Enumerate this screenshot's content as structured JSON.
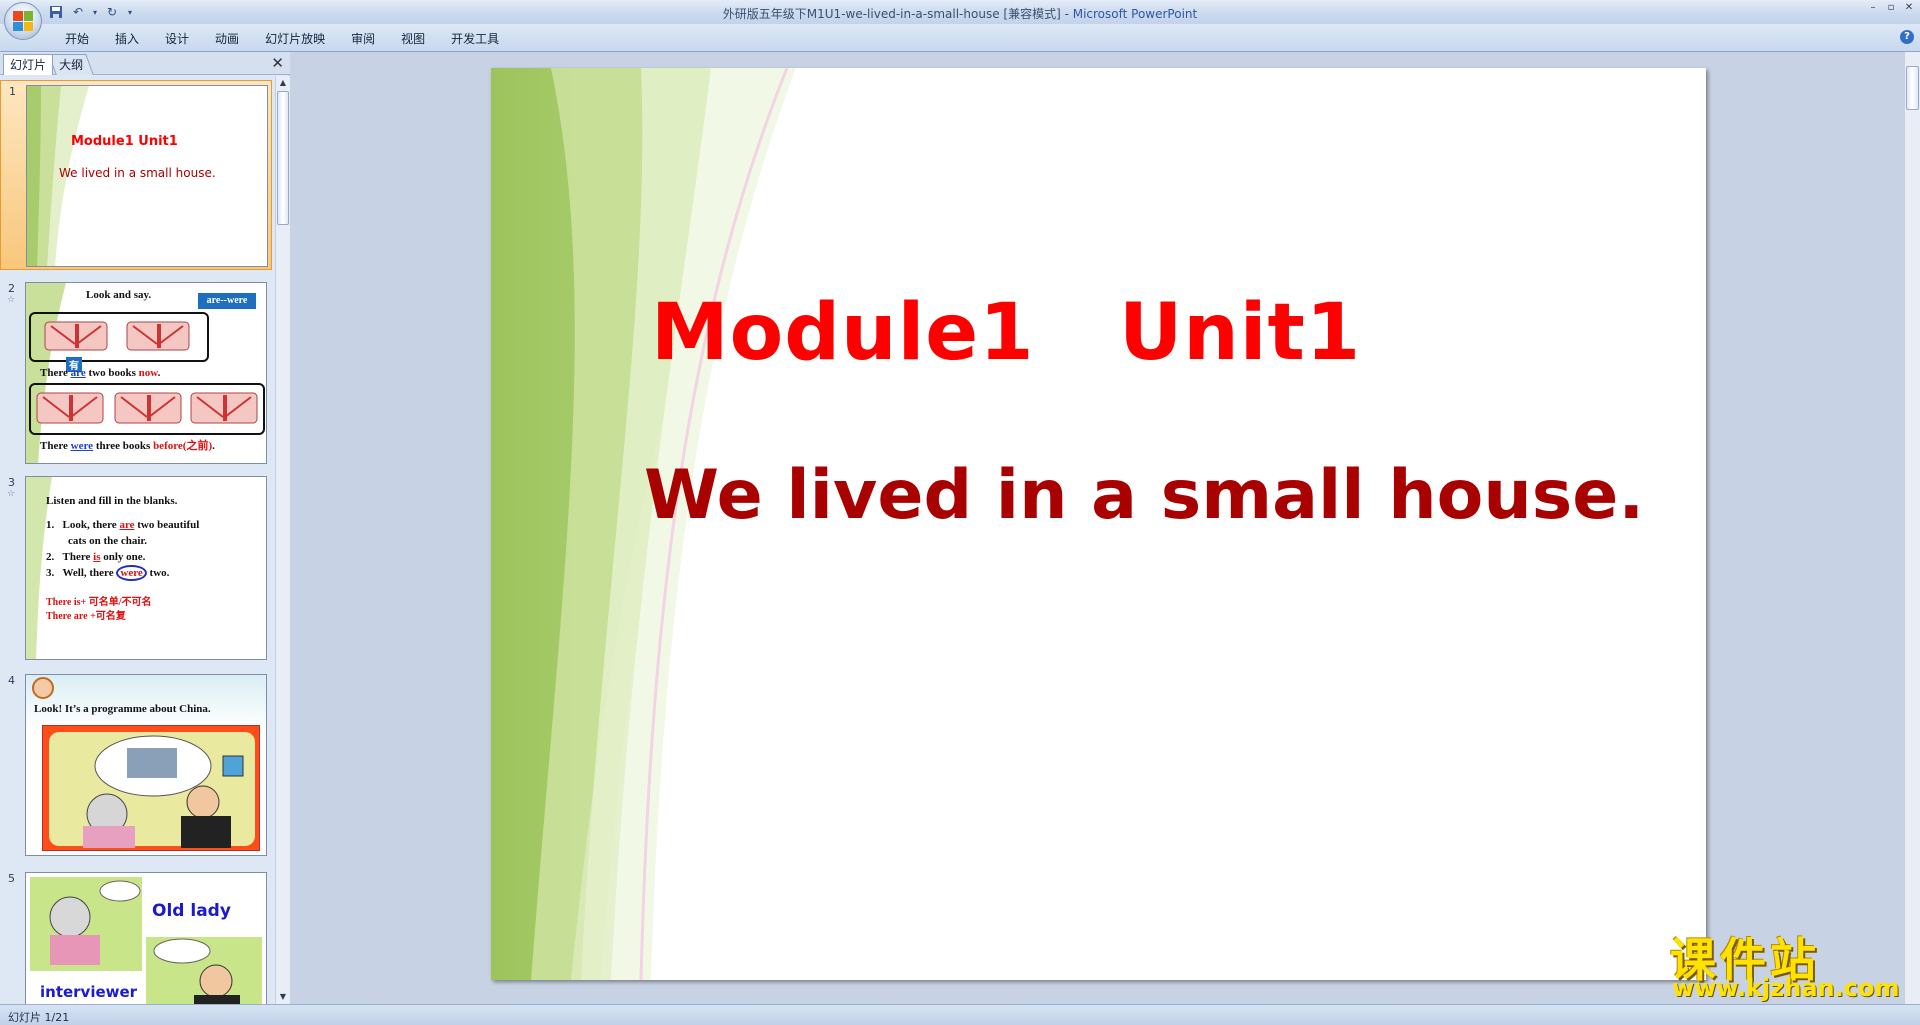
{
  "window": {
    "title_doc": "外研版五年级下M1U1-we-lived-in-a-small-house [兼容模式] - ",
    "title_app": "Microsoft PowerPoint",
    "min": "–",
    "restore": "▫",
    "close": "✕"
  },
  "ribbon": {
    "tabs": [
      "开始",
      "插入",
      "设计",
      "动画",
      "幻灯片放映",
      "审阅",
      "视图",
      "开发工具"
    ],
    "help": "?"
  },
  "panel": {
    "tab_slides": "幻灯片",
    "tab_outline": "大纲",
    "close": "✕"
  },
  "thumbnails": [
    {
      "num": "1",
      "title": "Module1  Unit1",
      "sub": "We lived in a small house."
    },
    {
      "num": "2",
      "heading": "Look and say.",
      "badge": "are--were",
      "line1_a": "There ",
      "line1_b": "are",
      "line1_c": " two books ",
      "line1_d": "now",
      "line1_e": ".",
      "tag": "有",
      "line2_a": "There ",
      "line2_b": "were",
      "line2_c": " three books ",
      "line2_d": "before(之前)",
      "line2_e": "."
    },
    {
      "num": "3",
      "heading": "Listen and fill in the blanks.",
      "l1n": "1.",
      "l1a": "Look, there ",
      "l1b": "are",
      "l1c": " two beautiful",
      "l1d": "cats on the chair.",
      "l2n": "2.",
      "l2a": "There ",
      "l2b": "is",
      "l2c": " only one.",
      "l3n": "3.",
      "l3a": "Well, there ",
      "l3b": "were",
      "l3c": " two.",
      "n1": "There is+ 可名单/不可名",
      "n2": "There are +可名复"
    },
    {
      "num": "4",
      "heading": "Look! It’s a programme about China."
    },
    {
      "num": "5",
      "label1": "Old lady",
      "label2": "interviewer"
    }
  ],
  "slide": {
    "title": "Module1   Unit1",
    "subtitle": "We lived in a small house."
  },
  "status": {
    "slide_counter": "幻灯片 1/21"
  },
  "watermark": {
    "title": "课件站",
    "url": "www.kjzhan.com"
  },
  "colors": {
    "title_red": "#ff0000",
    "subtitle_red": "#a90000",
    "selected_thumb": "#f9c77b"
  }
}
